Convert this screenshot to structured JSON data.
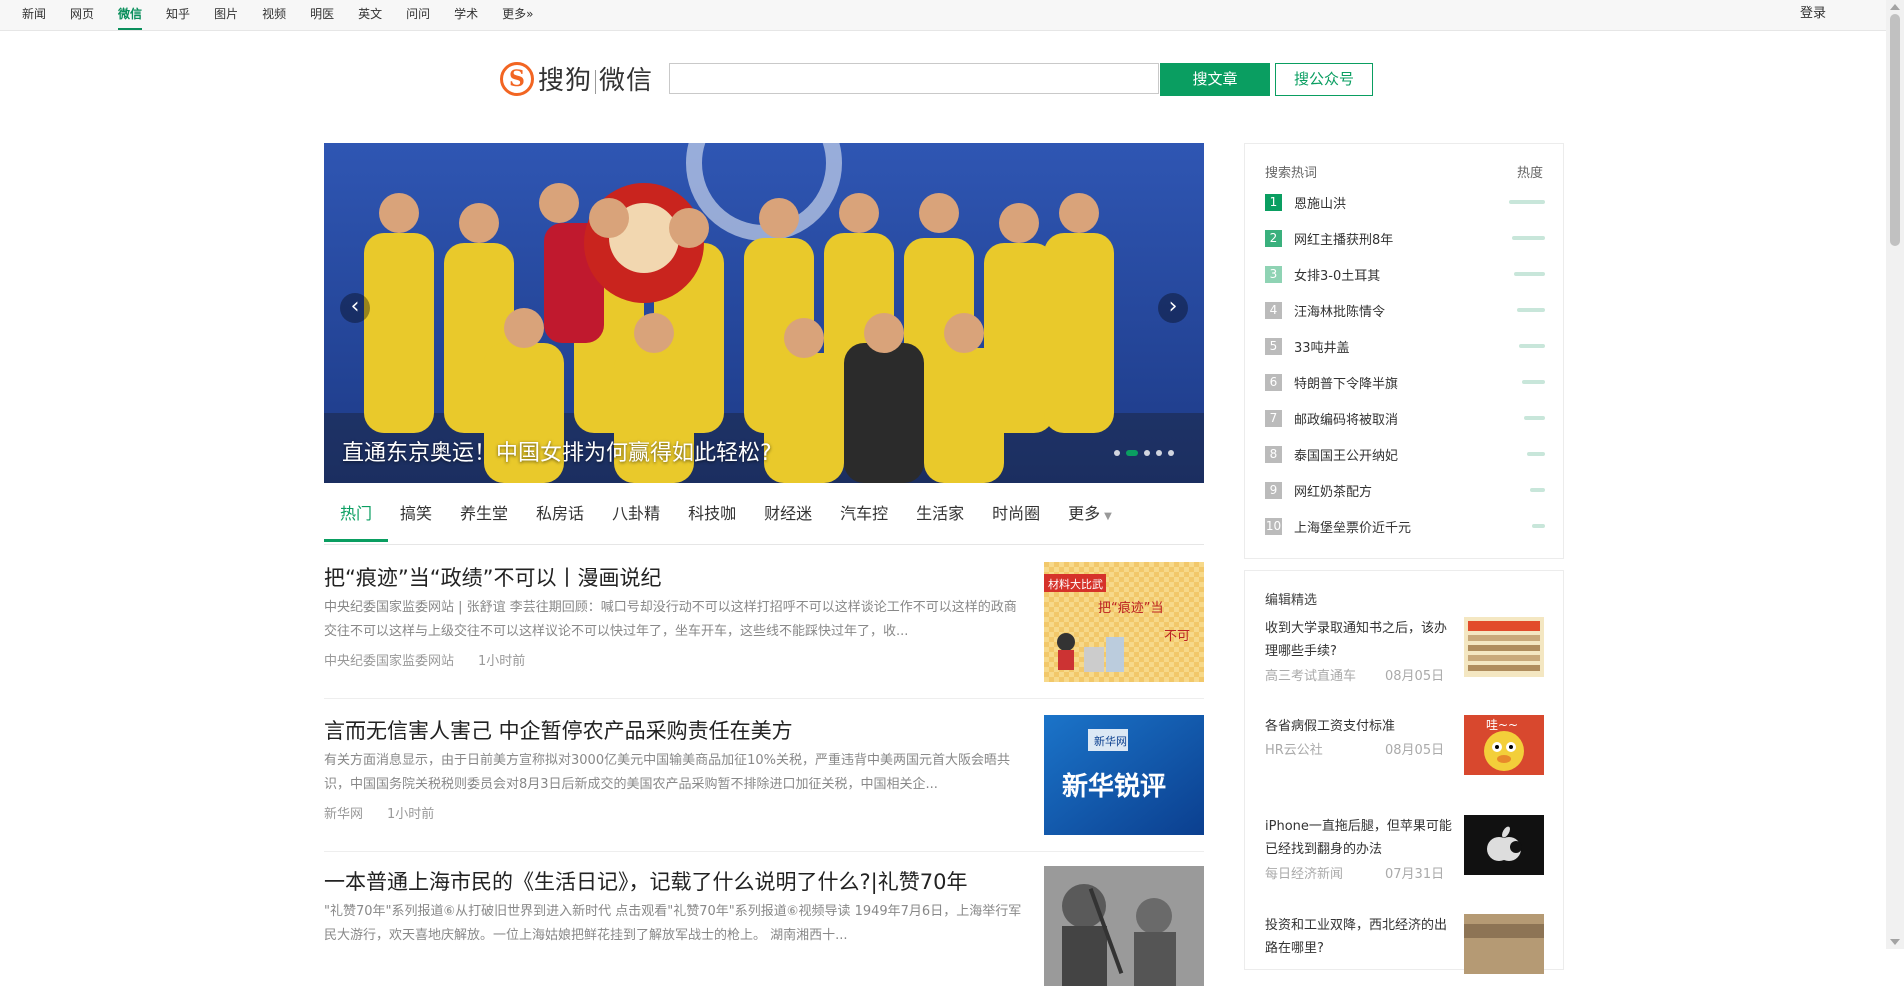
{
  "topnav": [
    "新闻",
    "网页",
    "微信",
    "知乎",
    "图片",
    "视频",
    "明医",
    "英文",
    "问问",
    "学术",
    "更多»"
  ],
  "login": "登录",
  "logo": {
    "mark": "S",
    "text_a": "搜狗",
    "text_b": "微信"
  },
  "search": {
    "value": "",
    "btn_article": "搜文章",
    "btn_account": "搜公众号"
  },
  "carousel": {
    "caption": "直通东京奥运！中国女排为何赢得如此轻松?",
    "prev": "‹",
    "next": "›"
  },
  "tabs": [
    "热门",
    "搞笑",
    "养生堂",
    "私房话",
    "八卦精",
    "科技咖",
    "财经迷",
    "汽车控",
    "生活家",
    "时尚圈",
    "更多"
  ],
  "articles": [
    {
      "title": "把“痕迹”当“政绩”不可以丨漫画说纪",
      "summary": "中央纪委国家监委网站 | 张舒谊 李芸往期回顾：喊口号却没行动不可以这样打招呼不可以这样谈论工作不可以这样的政商交往不可以这样与上级交往不可以这样议论不可以快过年了，坐车开车，这些线不能踩快过年了，收...",
      "source": "中央纪委国家监委网站",
      "time": "1小时前",
      "thumb": {
        "banner": "材料大比武",
        "big": "把“痕迹”当",
        "sub": "不可"
      }
    },
    {
      "title": "言而无信害人害己 中企暂停农产品采购责任在美方",
      "summary": "有关方面消息显示，由于日前美方宣称拟对3000亿美元中国输美商品加征10%关税，严重违背中美两国元首大阪会晤共识，中国国务院关税税则委员会对8月3日后新成交的美国农产品采购暂不排除进口加征关税，中国相关企...",
      "source": "新华网",
      "time": "1小时前",
      "thumb": {
        "big": "新华锐评",
        "small": "新华网"
      }
    },
    {
      "title": "一本普通上海市民的《生活日记》，记载了什么说明了什么?|礼赞70年",
      "summary": "\"礼赞70年\"系列报道⑥从打破旧世界到进入新时代        点击观看\"礼赞70年\"系列报道⑥视频导读        1949年7月6日，上海举行军民大游行，欢天喜地庆解放。一位上海姑娘把鲜花挂到了解放军战士的枪上。      湖南湘西十...",
      "source": "",
      "time": ""
    }
  ],
  "hot": {
    "header": "搜索热词",
    "heat_label": "热度",
    "items": [
      {
        "rank": "1",
        "text": "恩施山洪",
        "color": "#0a9e61",
        "heat": 1.0
      },
      {
        "rank": "2",
        "text": "网红主播获刑8年",
        "color": "#3ab07d",
        "heat": 0.93
      },
      {
        "rank": "3",
        "text": "女排3-0土耳其",
        "color": "#8fd3b4",
        "heat": 0.86
      },
      {
        "rank": "4",
        "text": "汪海林批陈情令",
        "color": "#bbbbbb",
        "heat": 0.79
      },
      {
        "rank": "5",
        "text": "33吨井盖",
        "color": "#bbbbbb",
        "heat": 0.72
      },
      {
        "rank": "6",
        "text": "特朗普下令降半旗",
        "color": "#bbbbbb",
        "heat": 0.65
      },
      {
        "rank": "7",
        "text": "邮政编码将被取消",
        "color": "#bbbbbb",
        "heat": 0.58
      },
      {
        "rank": "8",
        "text": "泰国国王公开纳妃",
        "color": "#bbbbbb",
        "heat": 0.5
      },
      {
        "rank": "9",
        "text": "网红奶茶配方",
        "color": "#bbbbbb",
        "heat": 0.43
      },
      {
        "rank": "10",
        "text": "上海堡垒票价近千元",
        "color": "#bbbbbb",
        "heat": 0.36
      }
    ]
  },
  "picks": {
    "header": "编辑精选",
    "items": [
      {
        "title": "收到大学录取通知书之后，该办理哪些手续?",
        "source": "高三考试直通车",
        "date": "08月05日"
      },
      {
        "title": "各省病假工资支付标准",
        "source": "HR云公社",
        "date": "08月05日",
        "thumb_text": "哇~~"
      },
      {
        "title": "iPhone一直拖后腿，但苹果可能已经找到翻身的办法",
        "source": "每日经济新闻",
        "date": "07月31日"
      },
      {
        "title": "投资和工业双降，西北经济的出路在哪里?",
        "source": "",
        "date": ""
      }
    ]
  }
}
